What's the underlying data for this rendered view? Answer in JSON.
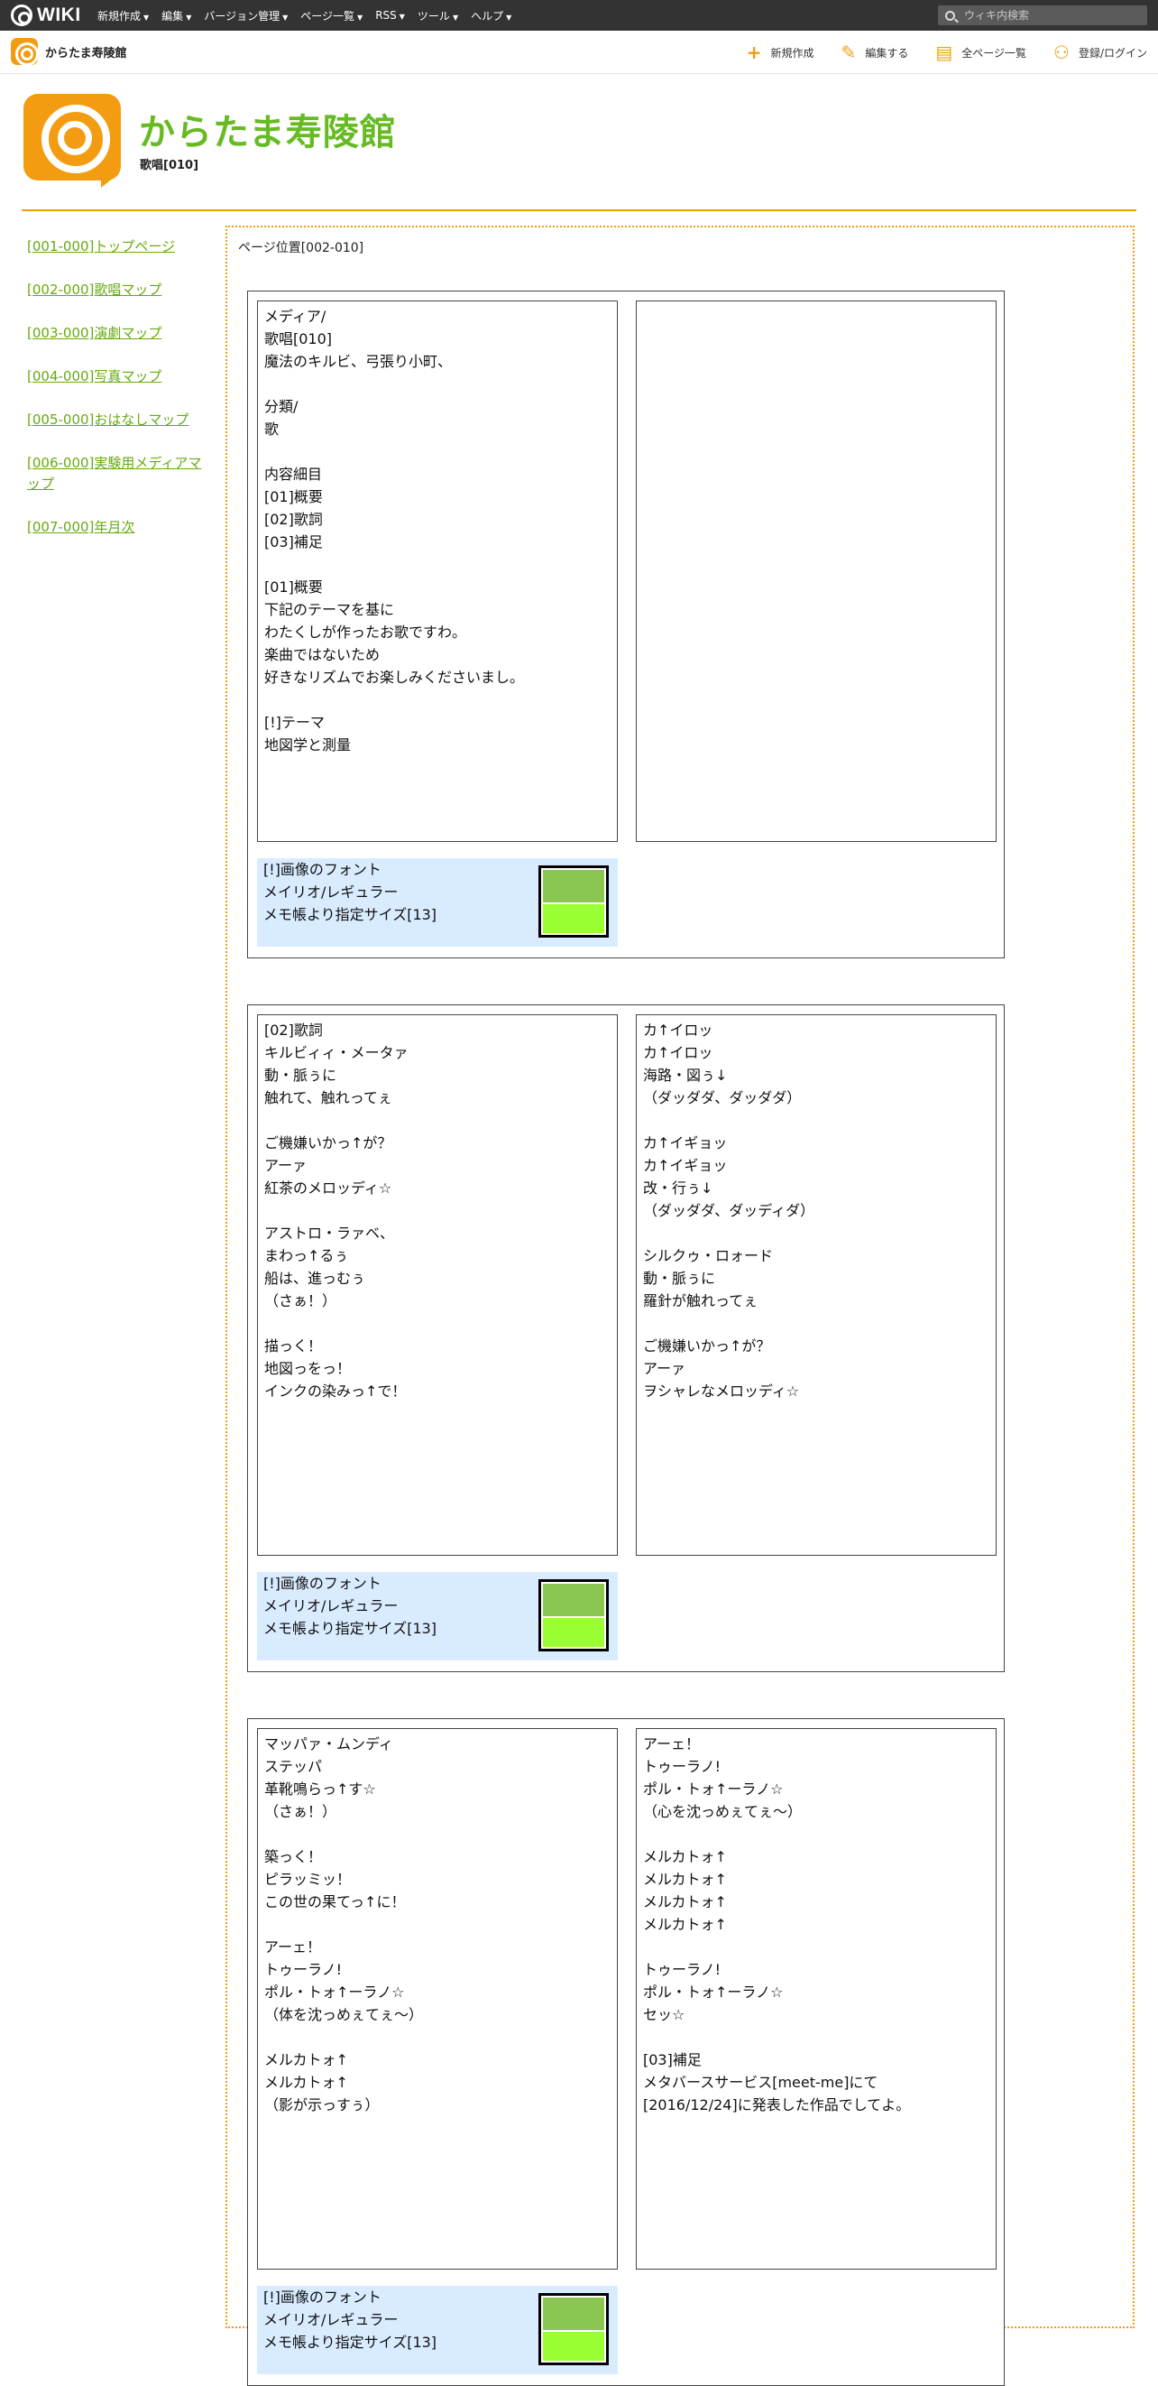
{
  "topbar": {
    "logo_text": "WIKI",
    "menu": [
      "新規作成",
      "編集",
      "バージョン管理",
      "ページ一覧",
      "RSS",
      "ツール",
      "ヘルプ"
    ],
    "search_placeholder": "ウィキ内検索"
  },
  "subbar": {
    "site_name": "からたま寿陵館",
    "actions": {
      "new": "新規作成",
      "edit": "編集する",
      "all_pages": "全ページ一覧",
      "login": "登録/ログイン"
    }
  },
  "header": {
    "title": "からたま寿陵館",
    "page_name": "歌唱[010]"
  },
  "nav": [
    "[001-000]トップページ",
    "[002-000]歌唱マップ",
    "[003-000]演劇マップ",
    "[004-000]写真マップ",
    "[005-000]おはなしマップ",
    "[006-000]実験用メディアマップ",
    "[007-000]年月次"
  ],
  "main": {
    "position": "ページ位置[002-010]",
    "cards": [
      {
        "left": "メディア/\n歌唱[010]\n魔法のキルビ、弓張り小町、\n\n分類/\n歌\n\n内容細目\n[01]概要\n[02]歌詞\n[03]補足\n\n[01]概要\n下記のテーマを基に\nわたくしが作ったお歌ですわ。\n楽曲ではないため\n好きなリズムでお楽しみくださいまし。\n\n[!]テーマ\n地図学と測量",
        "right": "",
        "note": [
          "[!]画像のフォント",
          "メイリオ/レギュラー",
          "メモ帳より指定サイズ[13]"
        ]
      },
      {
        "left": "[02]歌詞\nキルビィィ・メータァ\n動・脈ぅに\n触れて、触れってぇ\n\nご機嫌いかっ↑が？\nアーァ\n紅茶のメロッディ☆\n\nアストロ・ラァベ、\nまわっ↑るぅ\n船は、進っむぅ\n（さぁ！）\n\n描っく！\n地図っをっ！\nインクの染みっ↑で！",
        "right": "カ↑イロッ\nカ↑イロッ\n海路・図ぅ↓\n（ダッダダ、ダッダダ）\n\nカ↑イギョッ\nカ↑イギョッ\n改・行ぅ↓\n（ダッダダ、ダッディダ）\n\nシルクゥ・ロォード\n動・脈ぅに\n羅針が触れってぇ\n\nご機嫌いかっ↑が？\nアーァ\nヲシャレなメロッディ☆",
        "note": [
          "[!]画像のフォント",
          "メイリオ/レギュラー",
          "メモ帳より指定サイズ[13]"
        ]
      },
      {
        "left": "マッパァ・ムンディ\nステッパ\n革靴鳴らっ↑す☆\n（さぁ！）\n\n築っく！\nピラッミッ！\nこの世の果てっ↑に！\n\nアーェ！\nトゥーラノ!\nポル・トォ↑ーラノ☆\n（体を沈っめぇてぇ〜）\n\nメルカトォ↑\nメルカトォ↑\n（影が示っすぅ）",
        "right": "アーェ！\nトゥーラノ!\nポル・トォ↑ーラノ☆\n（心を沈っめぇてぇ〜）\n\nメルカトォ↑\nメルカトォ↑\nメルカトォ↑\nメルカトォ↑\n\nトゥーラノ!\nポル・トォ↑ーラノ☆\nセッ☆\n\n[03]補足\nメタバースサービス[meet-me]にて\n[2016/12/24]に発表した作品でしてよ。",
        "note": [
          "[!]画像のフォント",
          "メイリオ/レギュラー",
          "メモ帳より指定サイズ[13]"
        ]
      }
    ]
  },
  "colors": {
    "accent": "#f39c12",
    "title_green": "#66bb22",
    "link_green": "#66aa11",
    "note_bg": "#d9ecff",
    "swatch_top": "#8bc653",
    "swatch_bottom": "#99ff33"
  }
}
